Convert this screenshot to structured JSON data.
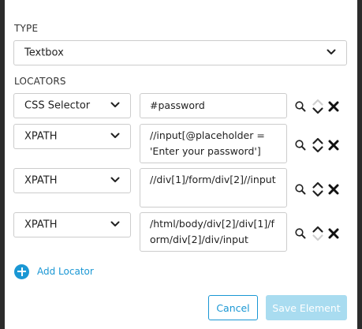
{
  "type_section": {
    "label": "TYPE",
    "selected": "Textbox"
  },
  "locators_section": {
    "label": "LOCATORS",
    "rows": [
      {
        "strategy": "CSS Selector",
        "value": "#password"
      },
      {
        "strategy": "XPATH",
        "value": "//input[@placeholder = 'Enter your password']"
      },
      {
        "strategy": "XPATH",
        "value": "//div[1]/form/div[2]//input"
      },
      {
        "strategy": "XPATH",
        "value": "/html/body/div[2]/div[1]/form/div[2]/div/input"
      }
    ],
    "add_label": "Add Locator"
  },
  "footer": {
    "cancel_label": "Cancel",
    "save_label": "Save Element"
  },
  "colors": {
    "accent": "#1a97d4",
    "save_disabled": "#a9dcf0",
    "border": "#cccccc",
    "backdrop": "#2b2b2b"
  },
  "icons": {
    "search": "search-icon",
    "move_up": "chevron-up-icon",
    "move_down": "chevron-down-icon",
    "remove": "close-icon",
    "add": "plus-circle-icon",
    "dropdown": "chevron-down-icon"
  }
}
